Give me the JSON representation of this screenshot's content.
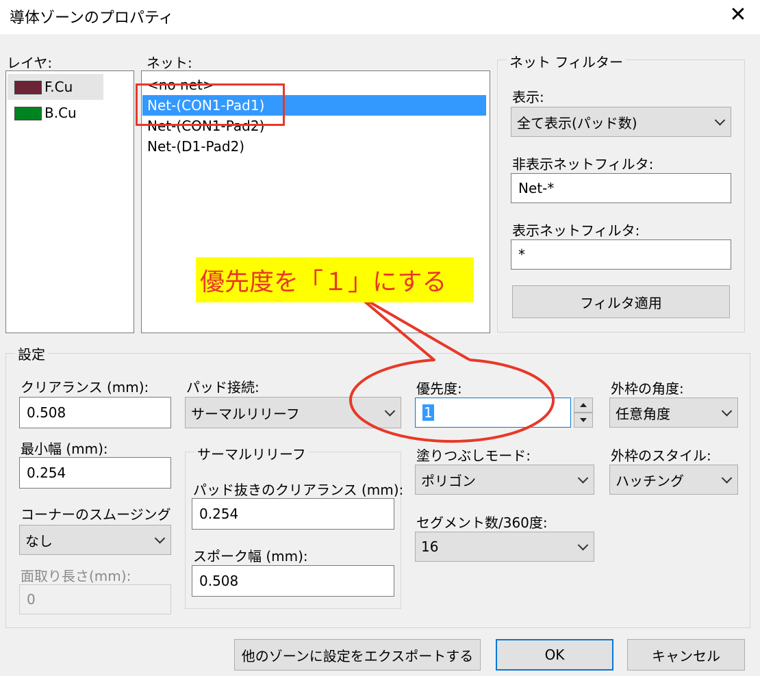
{
  "window": {
    "title": "導体ゾーンのプロパティ",
    "close_glyph": "✕"
  },
  "layers": {
    "label": "レイヤ:",
    "items": [
      {
        "name": "F.Cu",
        "color": "#6b2536"
      },
      {
        "name": "B.Cu",
        "color": "#00841f"
      }
    ]
  },
  "nets": {
    "label": "ネット:",
    "items": [
      "<no net>",
      "Net-(CON1-Pad1)",
      "Net-(CON1-Pad2)",
      "Net-(D1-Pad2)"
    ],
    "selected_index": 1
  },
  "net_filter": {
    "title": "ネット フィルター",
    "display_label": "表示:",
    "display_value": "全て表示(パッド数)",
    "hide_filter_label": "非表示ネットフィルタ:",
    "hide_filter_value": "Net-*",
    "show_filter_label": "表示ネットフィルタ:",
    "show_filter_value": "*",
    "apply_button": "フィルタ適用"
  },
  "settings": {
    "title": "設定",
    "clearance_label": "クリアランス (mm):",
    "clearance_value": "0.508",
    "min_width_label": "最小幅 (mm):",
    "min_width_value": "0.254",
    "corner_label": "コーナーのスムージング",
    "corner_value": "なし",
    "chamfer_label": "面取り長さ(mm):",
    "chamfer_value": "0",
    "pad_conn_label": "パッド接続:",
    "pad_conn_value": "サーマルリリーフ",
    "thermal_title": "サーマルリリーフ",
    "antipad_label": "パッド抜きのクリアランス (mm):",
    "antipad_value": "0.254",
    "spoke_label": "スポーク幅 (mm):",
    "spoke_value": "0.508",
    "priority_label": "優先度:",
    "priority_value": "1",
    "fill_mode_label": "塗りつぶしモード:",
    "fill_mode_value": "ポリゴン",
    "segments_label": "セグメント数/360度:",
    "segments_value": "16",
    "outline_angle_label": "外枠の角度:",
    "outline_angle_value": "任意角度",
    "outline_style_label": "外枠のスタイル:",
    "outline_style_value": "ハッチング"
  },
  "buttons": {
    "export": "他のゾーンに設定をエクスポートする",
    "ok": "OK",
    "cancel": "キャンセル"
  },
  "annotation": {
    "text": "優先度を「１」にする",
    "color": "#e83828",
    "background": "#ffff00"
  }
}
